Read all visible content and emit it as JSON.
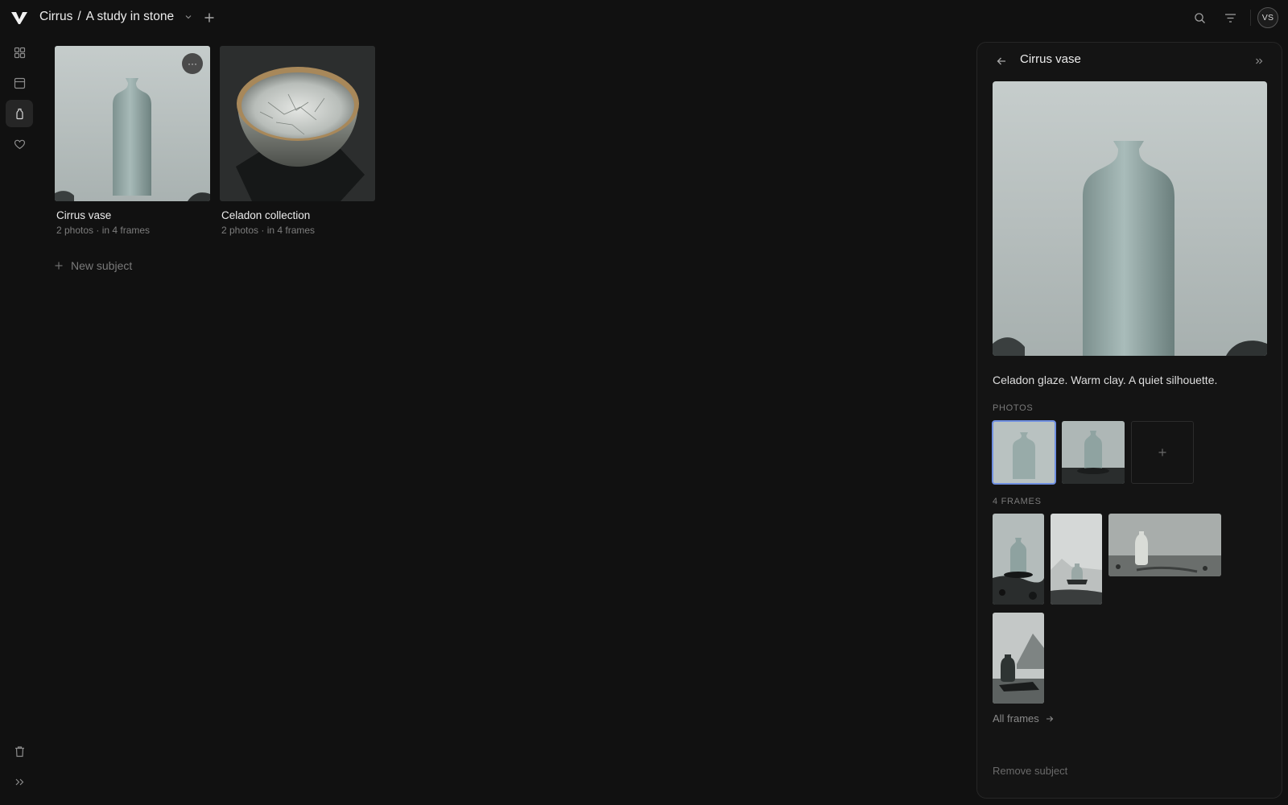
{
  "header": {
    "workspace": "Cirrus",
    "separator": "/",
    "project": "A study in stone",
    "user_initials": "VS"
  },
  "icons": {
    "logo": "logo-icon",
    "project_menu": "chevron-down-icon",
    "add": "plus-icon",
    "search": "search-icon",
    "filter": "filter-icon",
    "rail": [
      "grid-icon",
      "calendar-icon",
      "vase-icon",
      "heart-icon"
    ],
    "trash": "trash-icon",
    "expand": "chevrons-right-icon"
  },
  "subjects": [
    {
      "title": "Cirrus vase",
      "meta": "2 photos · in 4 frames"
    },
    {
      "title": "Celadon collection",
      "meta": "2 photos · in 4 frames"
    }
  ],
  "new_subject_label": "New subject",
  "more_label": "···",
  "panel": {
    "title": "Cirrus vase",
    "description": "Celadon glaze. Warm clay. A quiet silhouette.",
    "photos_label": "PHOTOS",
    "frames_label": "4 FRAMES",
    "all_frames_label": "All frames",
    "remove_label": "Remove subject"
  },
  "colors": {
    "background": "#111111",
    "panel": "#141414",
    "accent_selected": "#6f8fe0",
    "text_muted": "#7d7d7d"
  }
}
